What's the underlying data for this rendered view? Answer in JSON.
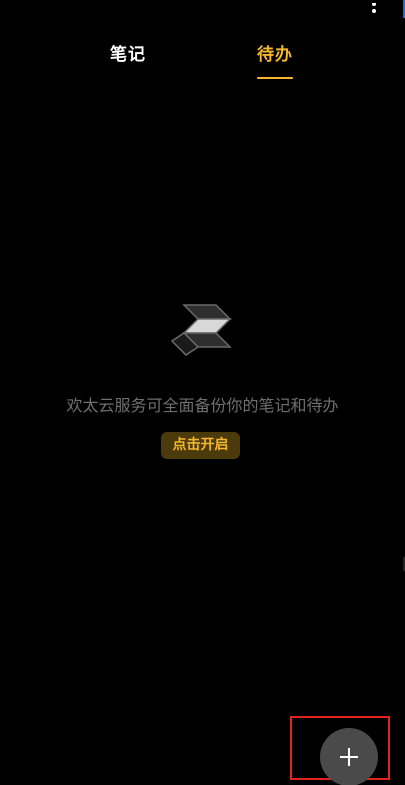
{
  "tabs": [
    {
      "label": "笔记",
      "active": false
    },
    {
      "label": "待办",
      "active": true
    }
  ],
  "empty_state": {
    "icon": "cloud-logo-icon",
    "message": "欢太云服务可全面备份你的笔记和待办",
    "button_label": "点击开启"
  },
  "fab": {
    "icon": "plus-icon"
  },
  "colors": {
    "background": "#000000",
    "accent": "#f5b82e",
    "inactive_text": "#ffffff",
    "muted_text": "#6f6f6f",
    "button_bg": "#4a3a0c",
    "fab_bg": "#4a4a4a",
    "highlight_border": "#e0231b"
  }
}
